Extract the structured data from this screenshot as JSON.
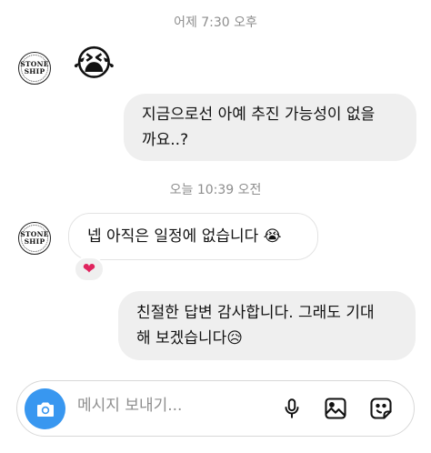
{
  "timestamps": {
    "first": "어제 7:30 오후",
    "second": "오늘 10:39 오전"
  },
  "avatar": {
    "logo_line1": "STONE",
    "logo_line2": "SHIP"
  },
  "messages": [
    {
      "direction": "incoming",
      "text": "😭"
    },
    {
      "direction": "outgoing",
      "line1": "지금으로선 아예 추진 가능성이 없을",
      "line2": "까요..?"
    },
    {
      "direction": "incoming",
      "text": "넵 아직은 일정에 없습니다 😭",
      "reaction": "❤"
    },
    {
      "direction": "outgoing",
      "line1": "친절한 답변 감사합니다. 그래도 기대",
      "line2": "해 보겠습니다😥"
    }
  ],
  "composer": {
    "placeholder": "메시지 보내기..."
  },
  "icons": {
    "camera": "camera-icon",
    "mic": "microphone-icon",
    "gallery": "gallery-icon",
    "sticker": "sticker-icon"
  },
  "colors": {
    "accent": "#3897f0",
    "bubble": "#efefef",
    "reaction": "#e0245e"
  }
}
